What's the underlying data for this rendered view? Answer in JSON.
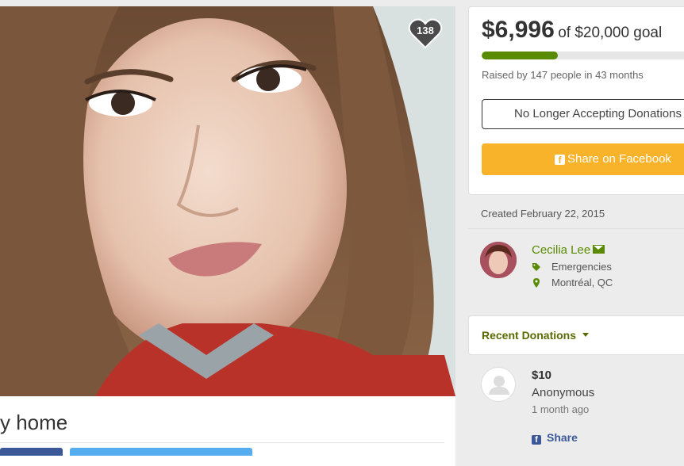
{
  "campaign": {
    "like_count": "138",
    "title_fragment": "y home"
  },
  "funding": {
    "raised": "$6,996",
    "goal_text": "of $20,000 goal",
    "progress_fraction": 0.35,
    "raised_by": "Raised by 147 people in 43 months",
    "status_button": "No Longer Accepting Donations",
    "share_button": "Share on Facebook"
  },
  "organizer": {
    "created": "Created February 22, 2015",
    "name": "Cecilia Lee",
    "category": "Emergencies",
    "location": "Montréal, QC"
  },
  "recent": {
    "label": "Recent Donations",
    "donations": [
      {
        "amount": "$10",
        "donor": "Anonymous",
        "time": "1 month ago",
        "share": "Share"
      }
    ]
  },
  "colors": {
    "accent_green": "#5a8a00",
    "facebook_button": "#f9b32a",
    "facebook_blue": "#3b5998"
  },
  "icons": [
    "heart-icon",
    "facebook-icon",
    "mail-icon",
    "tag-icon",
    "location-pin-icon",
    "caret-down-icon",
    "user-placeholder-icon"
  ]
}
